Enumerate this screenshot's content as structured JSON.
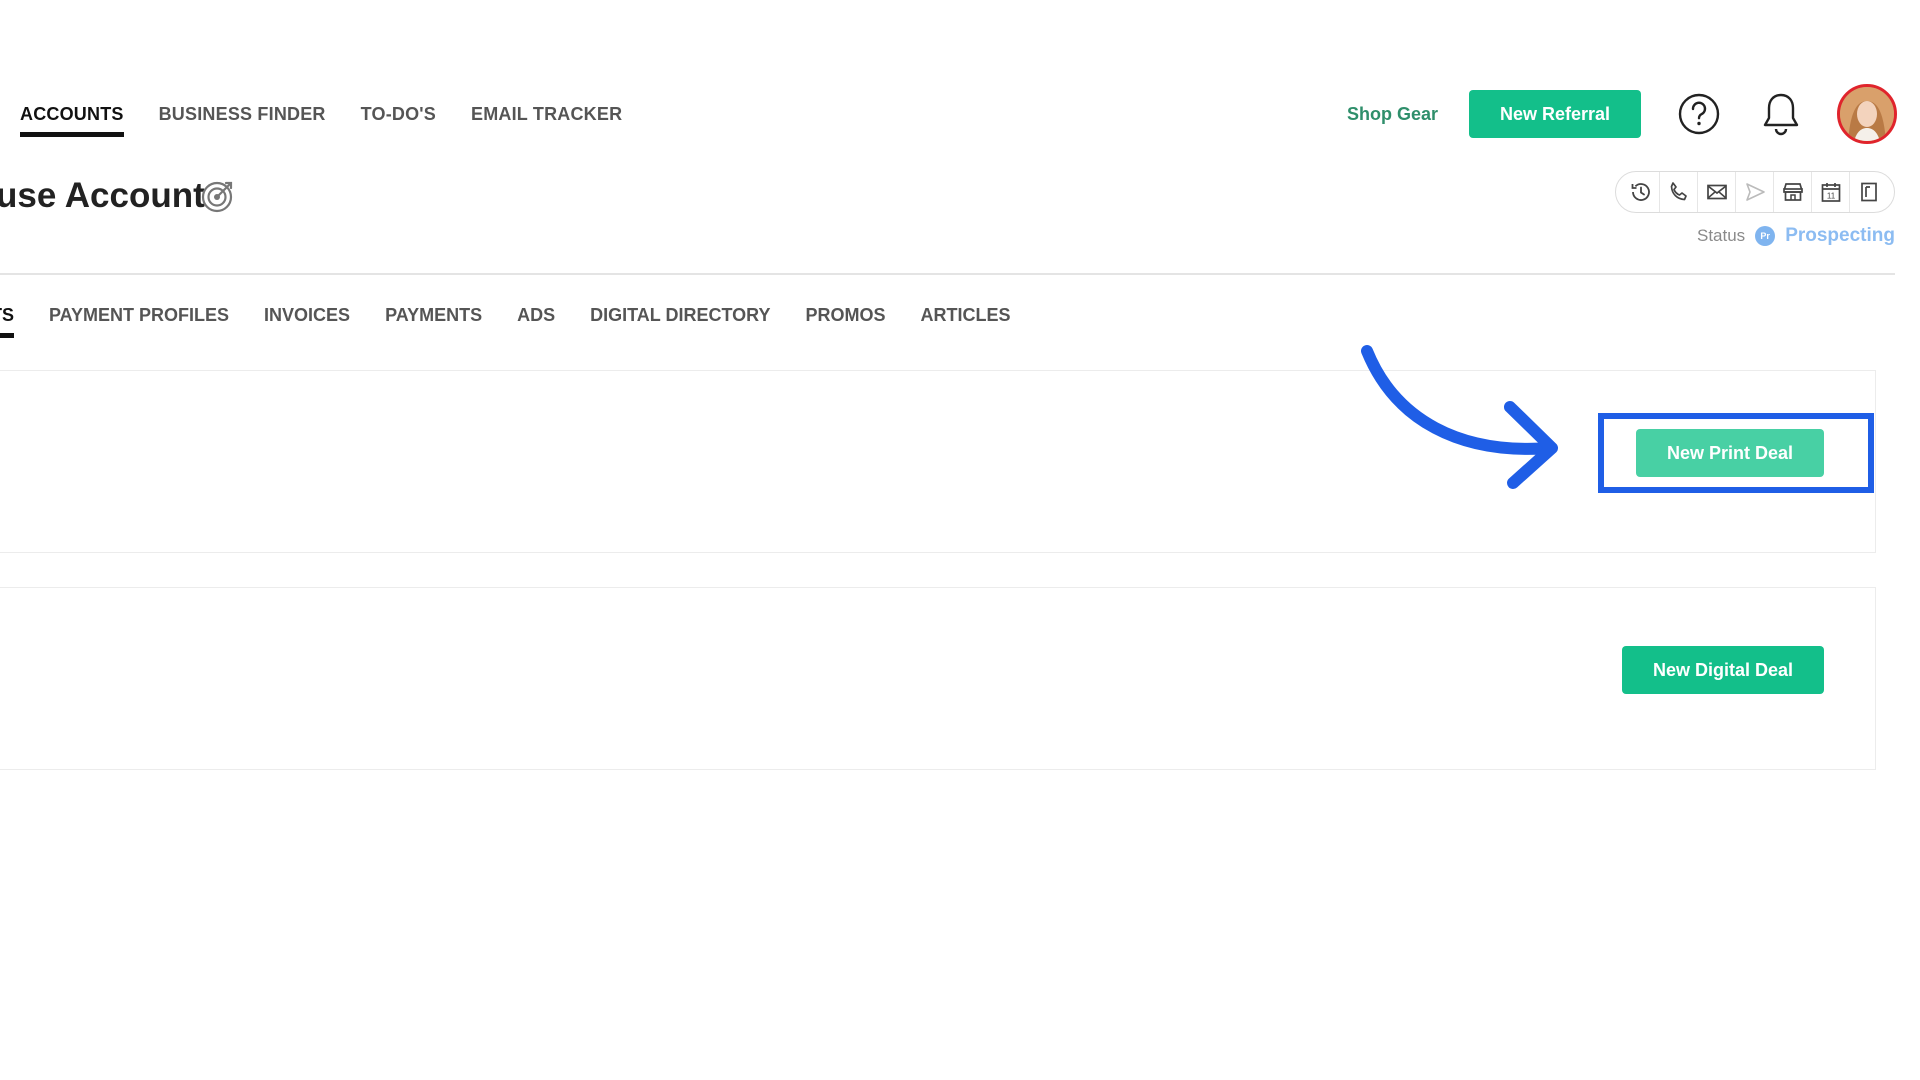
{
  "top_nav": {
    "items": [
      {
        "label": "ACCOUNTS",
        "active": true
      },
      {
        "label": "BUSINESS FINDER",
        "active": false
      },
      {
        "label": "TO-DO'S",
        "active": false
      },
      {
        "label": "EMAIL TRACKER",
        "active": false
      }
    ]
  },
  "header_actions": {
    "shop_gear": "Shop Gear",
    "new_referral": "New Referral"
  },
  "account": {
    "title": "use Account",
    "status_label": "Status",
    "status_badge": "Pr",
    "status_value": "Prospecting",
    "calendar_day": "11"
  },
  "sub_tabs": [
    {
      "label": "ITS",
      "active": true
    },
    {
      "label": "PAYMENT PROFILES",
      "active": false
    },
    {
      "label": "INVOICES",
      "active": false
    },
    {
      "label": "PAYMENTS",
      "active": false
    },
    {
      "label": "ADS",
      "active": false
    },
    {
      "label": "DIGITAL DIRECTORY",
      "active": false
    },
    {
      "label": "PROMOS",
      "active": false
    },
    {
      "label": "ARTICLES",
      "active": false
    }
  ],
  "deals": {
    "print_button": "New Print Deal",
    "digital_button": "New Digital Deal"
  },
  "colors": {
    "primary_green": "#13bf8a",
    "print_button_green": "#48d0a4",
    "shop_gear_text": "#2f8f6b",
    "status_blue": "#8cbcf2",
    "annotation_blue": "#1f5ee6",
    "avatar_ring": "#e0242c"
  }
}
